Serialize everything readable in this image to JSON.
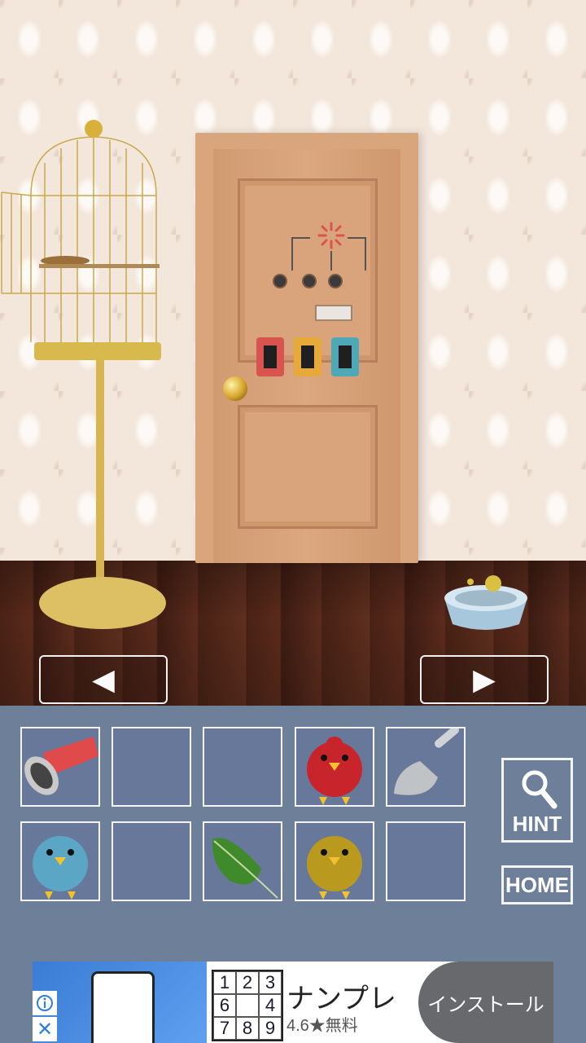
{
  "scene": {
    "nav_left_glyph": "◀",
    "nav_right_glyph": "▶",
    "device_colors": [
      "#d9534f",
      "#e6a93a",
      "#4fa8b8"
    ]
  },
  "inventory": {
    "slots": [
      {
        "item": "megaphone"
      },
      {
        "item": ""
      },
      {
        "item": ""
      },
      {
        "item": "red-bird"
      },
      {
        "item": "scoop"
      },
      {
        "item": "blue-bird"
      },
      {
        "item": ""
      },
      {
        "item": "leaf"
      },
      {
        "item": "yellow-bird"
      },
      {
        "item": ""
      }
    ],
    "hint_label": "HINT",
    "home_label": "HOME"
  },
  "ad": {
    "sudoku": [
      "1",
      "2",
      "3",
      "6",
      "",
      "4",
      "7",
      "8",
      "9"
    ],
    "title": "ナンプレ",
    "rating": "4.6★無料",
    "install_label": "インストール"
  }
}
